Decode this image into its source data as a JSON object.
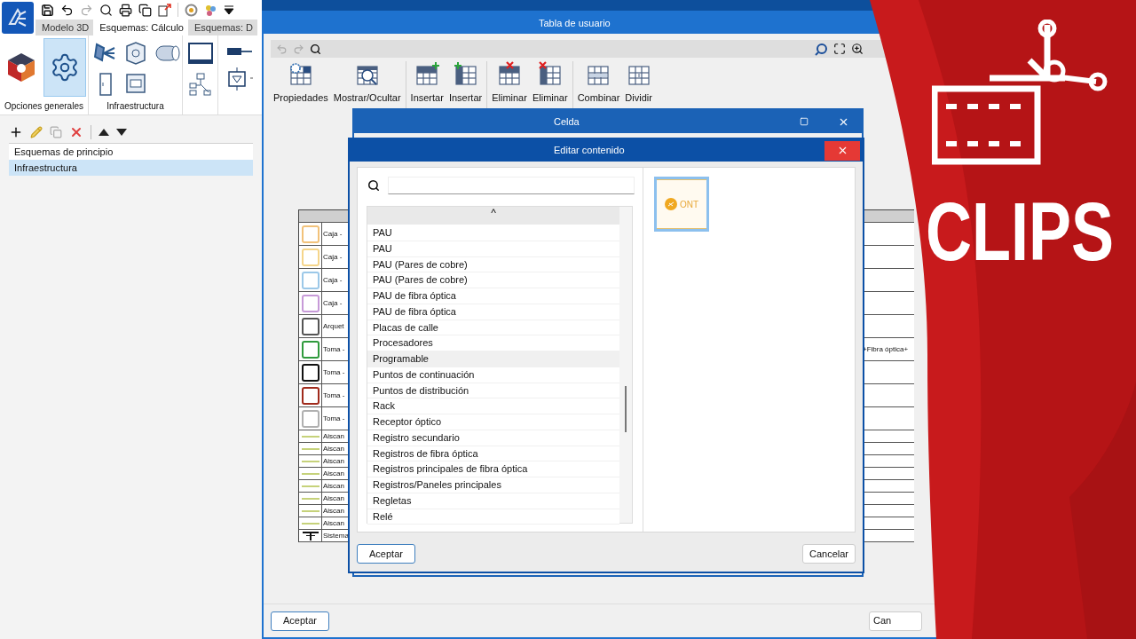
{
  "tabs": [
    {
      "label": "Modelo 3D",
      "selected": false
    },
    {
      "label": "Esquemas: Cálculo",
      "selected": true
    },
    {
      "label": "Esquemas: D",
      "selected": false
    }
  ],
  "ribbon_groups": [
    {
      "label": "Opciones generales"
    },
    {
      "label": "Infraestructura"
    }
  ],
  "schemes_list": [
    {
      "label": "Esquemas de principio",
      "selected": false
    },
    {
      "label": "Infraestructura",
      "selected": true
    }
  ],
  "user_table": {
    "title": "Tabla de usuario",
    "tools": [
      {
        "label": "Propiedades",
        "kind": "gear"
      },
      {
        "label": "Mostrar/Ocultar",
        "kind": "zoom"
      },
      {
        "label": "Insertar",
        "kind": "add-row"
      },
      {
        "label": "Insertar",
        "kind": "add-col"
      },
      {
        "label": "Eliminar",
        "kind": "del-row"
      },
      {
        "label": "Eliminar",
        "kind": "del-col"
      },
      {
        "label": "Combinar",
        "kind": "merge"
      },
      {
        "label": "Dividir",
        "kind": "split"
      }
    ],
    "rows": [
      {
        "kind": "box",
        "color": "#f2c27a",
        "name": "Caja -"
      },
      {
        "kind": "box",
        "color": "#f5d58a",
        "name": "Caja -"
      },
      {
        "kind": "box",
        "color": "#9cc8e8",
        "name": "Caja -"
      },
      {
        "kind": "box",
        "color": "#c79ad8",
        "name": "Caja -"
      },
      {
        "kind": "box",
        "color": "#555555",
        "name": "Arquet"
      },
      {
        "kind": "box",
        "color": "#2f9a3c",
        "name": "Toma -",
        "column_3": "+Fibra óptica+"
      },
      {
        "kind": "box",
        "color": "#111111",
        "name": "Toma -"
      },
      {
        "kind": "box",
        "color": "#a02a1c",
        "name": "Toma -"
      },
      {
        "kind": "box",
        "color": "#b0b0b0",
        "name": "Toma -"
      },
      {
        "kind": "line",
        "color": "#c6d27a",
        "name": "Aiscan"
      },
      {
        "kind": "line",
        "color": "#c6d27a",
        "name": "Aiscan"
      },
      {
        "kind": "line",
        "color": "#c6d27a",
        "name": "Aiscan"
      },
      {
        "kind": "line",
        "color": "#c6d27a",
        "name": "Aiscan"
      },
      {
        "kind": "line",
        "color": "#c6d27a",
        "name": "Aiscan"
      },
      {
        "kind": "line",
        "color": "#c6d27a",
        "name": "Aiscan"
      },
      {
        "kind": "line",
        "color": "#c6d27a",
        "name": "Aiscan"
      },
      {
        "kind": "line",
        "color": "#c6d27a",
        "name": "Aiscan"
      },
      {
        "kind": "ground",
        "color": "#111111",
        "name": "Sistema"
      }
    ],
    "ok": "Aceptar",
    "cancel": "Can"
  },
  "cell_window": {
    "title": "Celda"
  },
  "edit_dialog": {
    "title": "Editar contenido",
    "list_header": "^",
    "items": [
      {
        "label": "PAU",
        "hovered": false
      },
      {
        "label": "PAU",
        "hovered": false
      },
      {
        "label": "PAU (Pares de cobre)",
        "hovered": false
      },
      {
        "label": "PAU (Pares de cobre)",
        "hovered": false
      },
      {
        "label": "PAU de fibra óptica",
        "hovered": false
      },
      {
        "label": "PAU de fibra óptica",
        "hovered": false
      },
      {
        "label": "Placas de calle",
        "hovered": false
      },
      {
        "label": "Procesadores",
        "hovered": false
      },
      {
        "label": "Programable",
        "hovered": true
      },
      {
        "label": "Puntos de continuación",
        "hovered": false
      },
      {
        "label": "Puntos de distribución",
        "hovered": false
      },
      {
        "label": "Rack",
        "hovered": false
      },
      {
        "label": "Receptor óptico",
        "hovered": false
      },
      {
        "label": "Registro secundario",
        "hovered": false
      },
      {
        "label": "Registros de fibra óptica",
        "hovered": false
      },
      {
        "label": "Registros principales de fibra óptica",
        "hovered": false
      },
      {
        "label": "Registros/Paneles principales",
        "hovered": false
      },
      {
        "label": "Regletas",
        "hovered": false
      },
      {
        "label": "Relé",
        "hovered": false
      }
    ],
    "preview": {
      "label": "ONT",
      "selected": true
    },
    "ok": "Aceptar",
    "cancel": "Cancelar"
  },
  "overlay": {
    "text": "CLIPS"
  }
}
